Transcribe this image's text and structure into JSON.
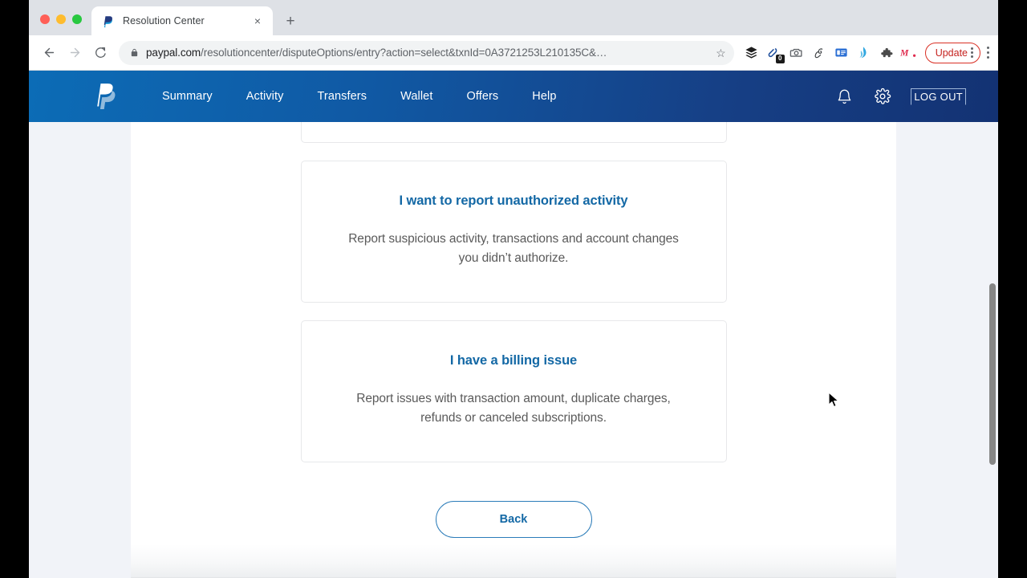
{
  "browser": {
    "tab": {
      "title": "Resolution Center",
      "favicon": "paypal-favicon",
      "close_label": "×"
    },
    "new_tab_label": "+",
    "nav": {
      "back": "←",
      "forward": "→",
      "reload": "⟳"
    },
    "omnibox": {
      "lock_icon": "lock-icon",
      "url_host": "paypal.com",
      "url_path": "/resolutioncenter/disputeOptions/entry?action=select&txnId=0A3721253L210135C&…",
      "star_icon": "☆"
    },
    "extensions": [
      {
        "name": "layers-stack-icon",
        "glyph": "layers"
      },
      {
        "name": "paperclip-link-icon",
        "glyph": "clip",
        "badge": "0"
      },
      {
        "name": "camera-icon",
        "glyph": "camera"
      },
      {
        "name": "goose-swirl-icon",
        "glyph": "swirl"
      },
      {
        "name": "card-reader-icon",
        "glyph": "card"
      },
      {
        "name": "wave-icon",
        "glyph": "wave"
      },
      {
        "name": "puzzle-piece-icon",
        "glyph": "puzzle"
      },
      {
        "name": "momentum-m-icon",
        "glyph": "M."
      }
    ],
    "update_button": {
      "label": "Update"
    }
  },
  "paypal_header": {
    "logo": "paypal-logo",
    "nav_items": [
      {
        "label": "Summary"
      },
      {
        "label": "Activity"
      },
      {
        "label": "Transfers"
      },
      {
        "label": "Wallet"
      },
      {
        "label": "Offers"
      },
      {
        "label": "Help"
      }
    ],
    "bell_icon": "notifications-bell-icon",
    "gear_icon": "settings-gear-icon",
    "logout_label": "LOG OUT"
  },
  "main": {
    "cards": [
      {
        "title": "I want to report unauthorized activity",
        "description": "Report suspicious activity, transactions and account changes you didn’t authorize."
      },
      {
        "title": "I have a billing issue",
        "description": "Report issues with transaction amount, duplicate charges, refunds or canceled subscriptions."
      }
    ],
    "back_button_label": "Back"
  },
  "colors": {
    "paypal_blue": "#1368a5",
    "header_gradient_start": "#0c6cb6",
    "header_gradient_end": "#133273",
    "page_gutter": "#f1f3f8",
    "card_border": "#e7e8ea",
    "update_red": "#c5221f"
  }
}
